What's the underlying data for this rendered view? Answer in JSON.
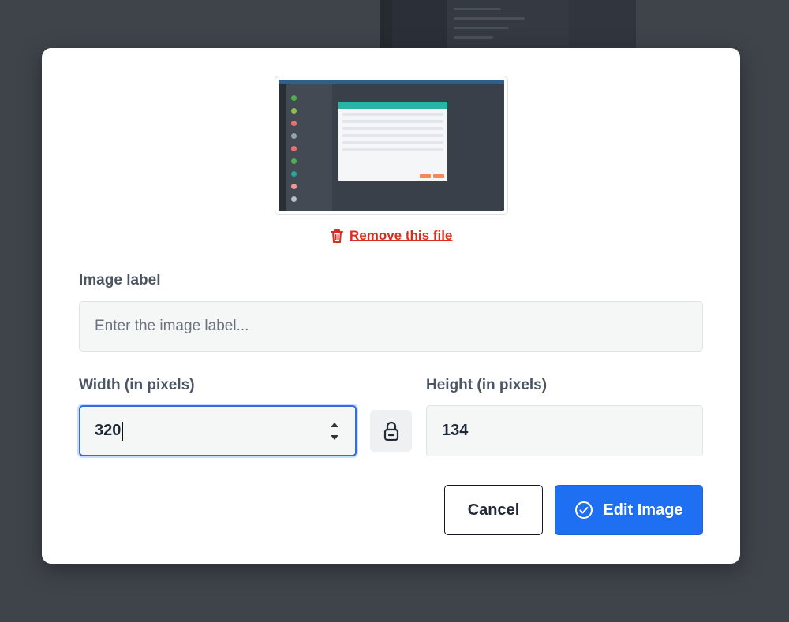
{
  "remove_file": {
    "label": "Remove this file"
  },
  "image_label": {
    "label": "Image label",
    "value": "",
    "placeholder": "Enter the image label..."
  },
  "width": {
    "label": "Width (in pixels)",
    "value": "320"
  },
  "height": {
    "label": "Height (in pixels)",
    "value": "134"
  },
  "actions": {
    "cancel": "Cancel",
    "submit": "Edit Image"
  },
  "icons": {
    "remove": "trash-icon",
    "lock": "lock-icon",
    "submit": "check-circle-icon",
    "spinner": "stepper-arrows-icon"
  },
  "colors": {
    "overlay": "#3f444b",
    "primary": "#1e6ff1",
    "danger": "#d92d20",
    "focus": "#2f6fe0"
  }
}
